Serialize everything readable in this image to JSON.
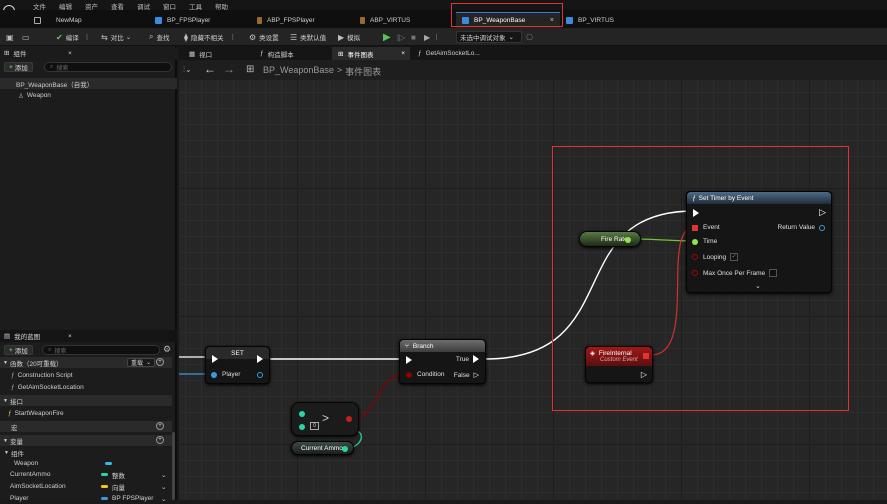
{
  "menubar": {
    "items": [
      "文件",
      "编辑",
      "资产",
      "查看",
      "调试",
      "窗口",
      "工具",
      "帮助"
    ]
  },
  "doc_tabs": [
    {
      "label": "NewMap",
      "icon": "map-icon"
    },
    {
      "label": "BP_FPSPlayer",
      "icon": "blueprint-icon"
    },
    {
      "label": "ABP_FPSPlayer",
      "icon": "anim-blueprint-icon"
    },
    {
      "label": "ABP_VIRTUS",
      "icon": "anim-blueprint-icon"
    },
    {
      "label": "BP_WeaponBase",
      "icon": "blueprint-icon",
      "active": true
    },
    {
      "label": "BP_VIRTUS",
      "icon": "blueprint-icon"
    }
  ],
  "toolbar": {
    "compile": "编译",
    "diff": "对比",
    "find": "查找",
    "hide_unrelated": "隐藏不相关",
    "class_settings": "类设置",
    "class_defaults": "类默认值",
    "simulate": "模拟",
    "debug_object": "未选中调试对象"
  },
  "components_panel": {
    "title": "组件",
    "add_label": "添加",
    "search_placeholder": "搜索",
    "root": "BP_WeaponBase（自我）",
    "children": [
      "Weapon"
    ]
  },
  "my_blueprint": {
    "title": "我的蓝图",
    "add_label": "添加",
    "search_placeholder": "搜索",
    "graphs_section": "函数（20可重载）",
    "override_label": "重载",
    "functions": [
      "Construction Script",
      "GetAimSocketLocation"
    ],
    "interfaces_section": "接口",
    "interface_items": [
      "StartWeaponFire"
    ],
    "macros_section": "宏",
    "variables_section": "变量",
    "components_sub": "组件",
    "variables": [
      {
        "name": "Weapon",
        "type": "",
        "color": "#33bbdd"
      },
      {
        "name": "CurrentAmmo",
        "type": "整数",
        "color": "#27d6a6"
      },
      {
        "name": "AimSocketLocation",
        "type": "向量",
        "color": "#f7c51e"
      },
      {
        "name": "Player",
        "type": "BP FPSPlayer",
        "color": "#3a9bdc"
      }
    ]
  },
  "graph_tabs": [
    {
      "label": "视口",
      "icon": "viewport-icon"
    },
    {
      "label": "构造脚本",
      "icon": "function-icon"
    },
    {
      "label": "事件图表",
      "icon": "graph-icon",
      "active": true
    },
    {
      "label": "GetAimSocketLo...",
      "icon": "function-icon"
    }
  ],
  "breadcrumb": {
    "blueprint": "BP_WeaponBase",
    "separator": ">",
    "graph": "事件图表"
  },
  "nodes": {
    "set": {
      "title": "SET",
      "pin": "Player"
    },
    "branch": {
      "title": "Branch",
      "condition": "Condition",
      "true_label": "True",
      "false_label": "False"
    },
    "compare": {
      "title": ">"
    },
    "current_ammo": {
      "title": "Current Ammo"
    },
    "fire_rate": {
      "title": "Fire Rate"
    },
    "fire_internal": {
      "title": "FireInternal",
      "subtitle": "Custom Event"
    },
    "set_timer": {
      "title": "Set Timer by Event",
      "event": "Event",
      "time": "Time",
      "looping": "Looping",
      "max_once": "Max Once Per Frame",
      "return_value": "Return Value"
    }
  },
  "colors": {
    "accent": "#3a7bd5",
    "highlight": "#e03333",
    "exec": "#ffffff",
    "bool_pin": "#8c0000",
    "float_pin": "#92e34f",
    "int_pin": "#27d6a6",
    "object_pin": "#3a9bdc"
  }
}
